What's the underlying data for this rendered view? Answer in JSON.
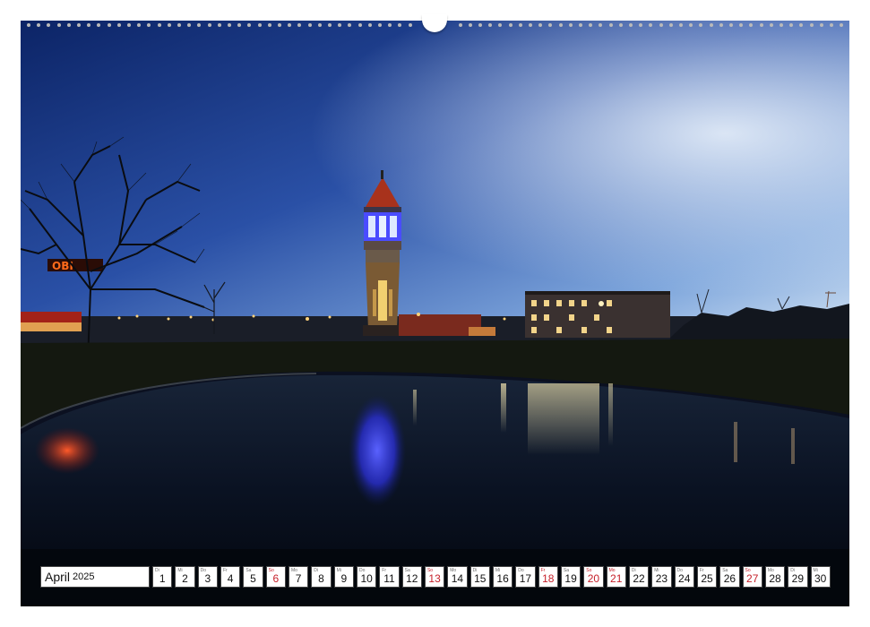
{
  "calendar": {
    "month": "April",
    "year": "2025",
    "days": [
      {
        "wd": "Di",
        "num": "1",
        "red": false
      },
      {
        "wd": "Mi",
        "num": "2",
        "red": false
      },
      {
        "wd": "Do",
        "num": "3",
        "red": false
      },
      {
        "wd": "Fr",
        "num": "4",
        "red": false
      },
      {
        "wd": "Sa",
        "num": "5",
        "red": false
      },
      {
        "wd": "So",
        "num": "6",
        "red": true
      },
      {
        "wd": "Mo",
        "num": "7",
        "red": false
      },
      {
        "wd": "Di",
        "num": "8",
        "red": false
      },
      {
        "wd": "Mi",
        "num": "9",
        "red": false
      },
      {
        "wd": "Do",
        "num": "10",
        "red": false
      },
      {
        "wd": "Fr",
        "num": "11",
        "red": false
      },
      {
        "wd": "Sa",
        "num": "12",
        "red": false
      },
      {
        "wd": "So",
        "num": "13",
        "red": true
      },
      {
        "wd": "Mo",
        "num": "14",
        "red": false
      },
      {
        "wd": "Di",
        "num": "15",
        "red": false
      },
      {
        "wd": "Mi",
        "num": "16",
        "red": false
      },
      {
        "wd": "Do",
        "num": "17",
        "red": false
      },
      {
        "wd": "Fr",
        "num": "18",
        "red": true
      },
      {
        "wd": "Sa",
        "num": "19",
        "red": false
      },
      {
        "wd": "So",
        "num": "20",
        "red": true
      },
      {
        "wd": "Mo",
        "num": "21",
        "red": true
      },
      {
        "wd": "Di",
        "num": "22",
        "red": false
      },
      {
        "wd": "Mi",
        "num": "23",
        "red": false
      },
      {
        "wd": "Do",
        "num": "24",
        "red": false
      },
      {
        "wd": "Fr",
        "num": "25",
        "red": false
      },
      {
        "wd": "Sa",
        "num": "26",
        "red": false
      },
      {
        "wd": "So",
        "num": "27",
        "red": true
      },
      {
        "wd": "Mo",
        "num": "28",
        "red": false
      },
      {
        "wd": "Di",
        "num": "29",
        "red": false
      },
      {
        "wd": "Mi",
        "num": "30",
        "red": false
      }
    ]
  },
  "photo": {
    "store_sign": "OBI"
  },
  "colors": {
    "sunday_red": "#c6202a",
    "sky_top": "#0e2c78",
    "sky_bottom": "#b9d3ee",
    "tower_glow": "#5a66ff"
  }
}
